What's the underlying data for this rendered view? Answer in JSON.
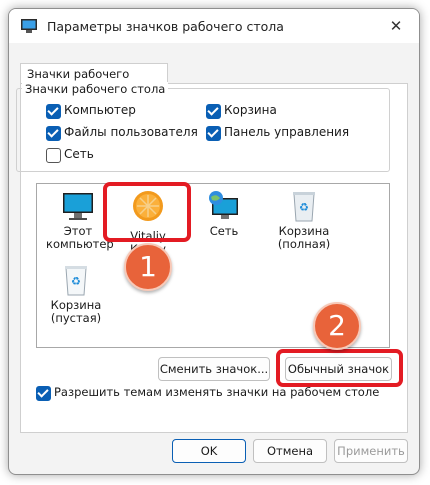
{
  "window": {
    "title": "Параметры значков рабочего стола"
  },
  "tab": {
    "label": "Значки рабочего стола"
  },
  "group": {
    "label": "Значки рабочего стола",
    "checkboxes": [
      {
        "label": "Компьютер",
        "checked": true
      },
      {
        "label": "Корзина",
        "checked": true
      },
      {
        "label": "Файлы пользователя",
        "checked": true
      },
      {
        "label": "Панель управления",
        "checked": true
      },
      {
        "label": "Сеть",
        "checked": false
      }
    ]
  },
  "icons": [
    {
      "label": "Этот компьютер",
      "icon": "monitor-icon"
    },
    {
      "label": "Vitaliy Kairov",
      "icon": "orange-user-icon"
    },
    {
      "label": "Сеть",
      "icon": "network-icon"
    },
    {
      "label": "Корзина (полная)",
      "icon": "recycle-bin-full-icon"
    },
    {
      "label": "Корзина (пустая)",
      "icon": "recycle-bin-empty-icon"
    }
  ],
  "buttons": {
    "change_icon": "Сменить значок...",
    "default_icon": "Обычный значок",
    "ok": "OK",
    "cancel": "Отмена",
    "apply": "Применить"
  },
  "allow_themes": {
    "label": "Разрешить темам изменять значки на рабочем столе",
    "checked": true
  },
  "badges": {
    "one": "1",
    "two": "2"
  },
  "colors": {
    "highlight": "#e31b23",
    "badge": "#e8633a",
    "accent": "#0a5fb4"
  }
}
